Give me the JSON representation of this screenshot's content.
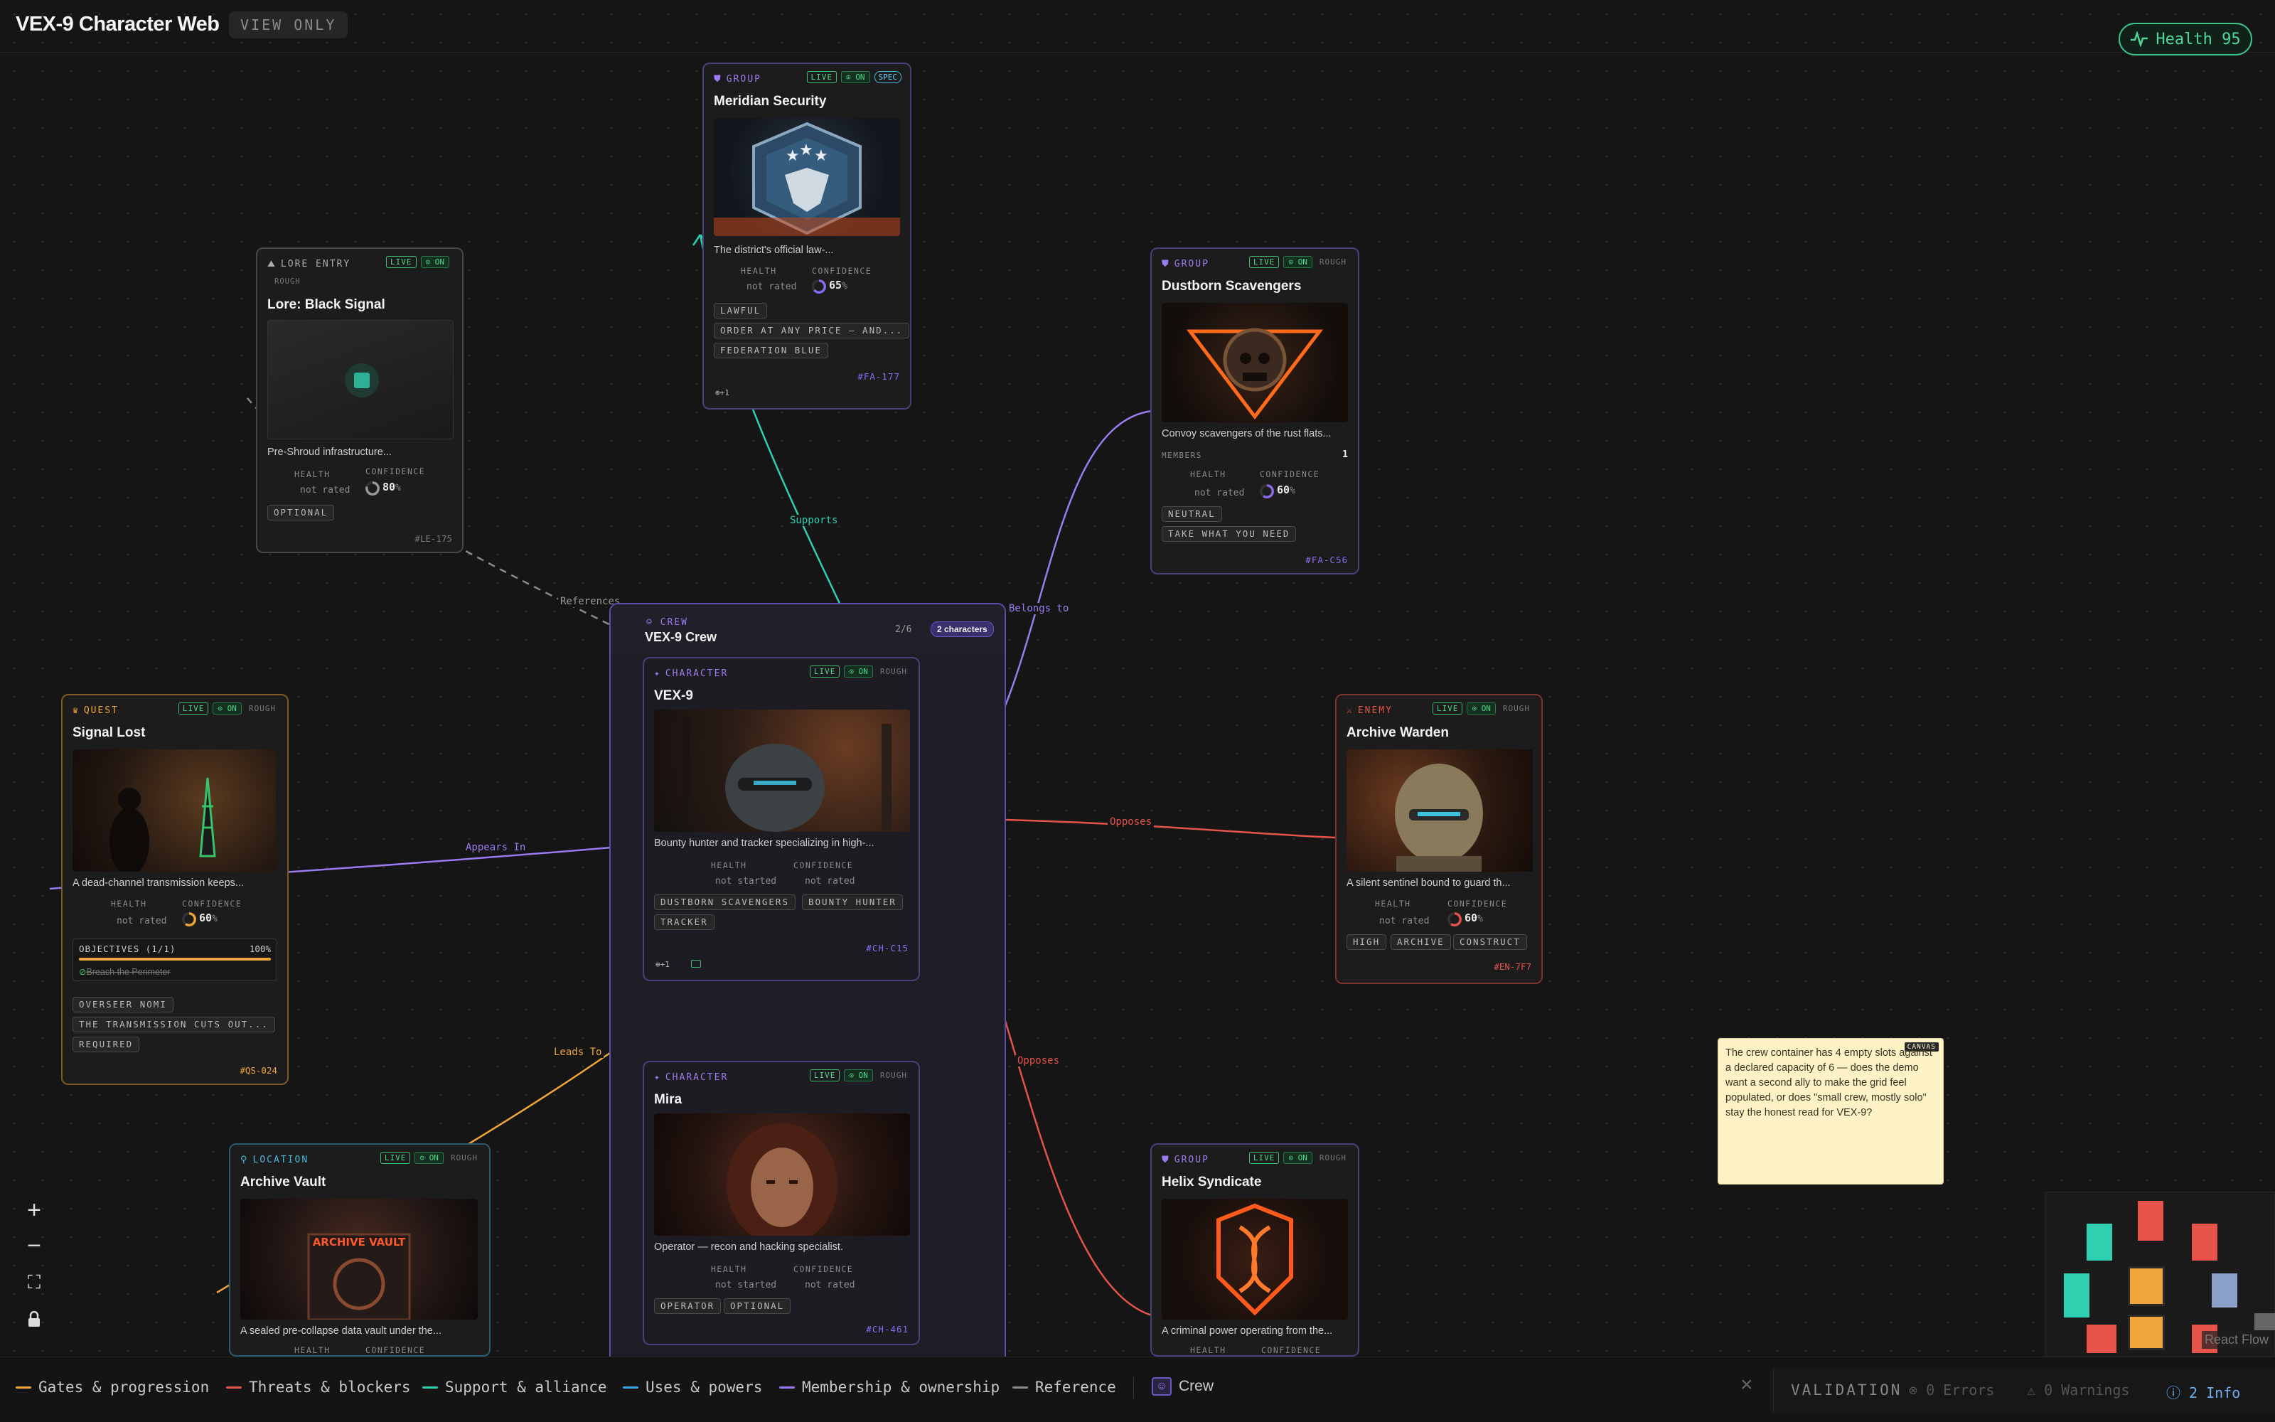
{
  "header": {
    "title": "VEX-9 Character Web",
    "view_badge": "VIEW ONLY",
    "health": "Health 95"
  },
  "edges": {
    "supports": "Supports",
    "references": "References",
    "belongs_to": "Belongs to",
    "opposes_1": "Opposes",
    "opposes_2": "Opposes",
    "appears_in": "Appears In",
    "leads_to": "Leads To"
  },
  "crew": {
    "kind": "CREW",
    "title": "VEX-9 Crew",
    "count": "2/6",
    "characters": "2 characters"
  },
  "cards": {
    "meridian": {
      "kind": "GROUP",
      "live": "LIVE",
      "on": "ON",
      "spec": "SPEC",
      "title": "Meridian Security",
      "desc": "The district's official law-...",
      "health_label": "HEALTH",
      "health": "not rated",
      "conf_label": "CONFIDENCE",
      "conf": "65",
      "conf_unit": "%",
      "tags": [
        "LAWFUL",
        "ORDER AT ANY PRICE — AND...",
        "FEDERATION BLUE"
      ],
      "links": "⊕+1",
      "id": "#FA-177"
    },
    "lore": {
      "kind": "LORE ENTRY",
      "live": "LIVE",
      "on": "ON",
      "rough": "ROUGH",
      "title": "Lore: Black Signal",
      "desc": "Pre-Shroud infrastructure...",
      "health_label": "HEALTH",
      "health": "not rated",
      "conf_label": "CONFIDENCE",
      "conf": "80",
      "conf_unit": "%",
      "tags": [
        "OPTIONAL"
      ],
      "id": "#LE-175"
    },
    "dustborn": {
      "kind": "GROUP",
      "live": "LIVE",
      "on": "ON",
      "rough": "ROUGH",
      "title": "Dustborn Scavengers",
      "desc": "Convoy scavengers of the rust flats...",
      "members_label": "MEMBERS",
      "members": "1",
      "health_label": "HEALTH",
      "health": "not rated",
      "conf_label": "CONFIDENCE",
      "conf": "60",
      "conf_unit": "%",
      "tags": [
        "NEUTRAL",
        "TAKE WHAT YOU NEED"
      ],
      "id": "#FA-C56"
    },
    "signal": {
      "kind": "QUEST",
      "live": "LIVE",
      "on": "ON",
      "rough": "ROUGH",
      "title": "Signal Lost",
      "desc": "A dead-channel transmission keeps...",
      "health_label": "HEALTH",
      "health": "not rated",
      "conf_label": "CONFIDENCE",
      "conf": "60",
      "conf_unit": "%",
      "objectives": "OBJECTIVES (1/1)",
      "objectives_pct": "100%",
      "objective_progress": 1.0,
      "objective_item": "Breach the Perimeter",
      "tags": [
        "OVERSEER NOMI",
        "THE TRANSMISSION CUTS OUT...",
        "REQUIRED"
      ],
      "id": "#QS-024"
    },
    "vex": {
      "kind": "CHARACTER",
      "live": "LIVE",
      "on": "ON",
      "rough": "ROUGH",
      "title": "VEX-9",
      "desc": "Bounty hunter and tracker specializing in high-...",
      "health_label": "HEALTH",
      "health": "not started",
      "conf_label": "CONFIDENCE",
      "conf": "not rated",
      "tags": [
        "DUSTBORN SCAVENGERS",
        "BOUNTY HUNTER",
        "TRACKER"
      ],
      "links": "⊕+1",
      "id": "#CH-C15"
    },
    "warden": {
      "kind": "ENEMY",
      "live": "LIVE",
      "on": "ON",
      "rough": "ROUGH",
      "title": "Archive Warden",
      "desc": "A silent sentinel bound to guard th...",
      "health_label": "HEALTH",
      "health": "not rated",
      "conf_label": "CONFIDENCE",
      "conf": "60",
      "conf_unit": "%",
      "tags": [
        "HIGH",
        "ARCHIVE",
        "CONSTRUCT"
      ],
      "id": "#EN-7F7"
    },
    "mira": {
      "kind": "CHARACTER",
      "live": "LIVE",
      "on": "ON",
      "rough": "ROUGH",
      "title": "Mira",
      "desc": "Operator — recon and hacking specialist.",
      "health_label": "HEALTH",
      "health": "not started",
      "conf_label": "CONFIDENCE",
      "conf": "not rated",
      "tags": [
        "OPERATOR",
        "OPTIONAL"
      ],
      "id": "#CH-461"
    },
    "vault": {
      "kind": "LOCATION",
      "live": "LIVE",
      "on": "ON",
      "rough": "ROUGH",
      "title": "Archive Vault",
      "img_text": "ARCHIVE VAULT",
      "desc": "A sealed pre-collapse data vault under the...",
      "health_label": "HEALTH",
      "conf_label": "CONFIDENCE"
    },
    "helix": {
      "kind": "GROUP",
      "live": "LIVE",
      "on": "ON",
      "rough": "ROUGH",
      "title": "Helix Syndicate",
      "desc": "A criminal power operating from the...",
      "health_label": "HEALTH",
      "conf_label": "CONFIDENCE"
    }
  },
  "note": {
    "tag": "CANVAS",
    "text": "The crew container has 4 empty slots against a declared capacity of 6 — does the demo want a second ally to make the grid feel populated, or does \"small crew, mostly solo\" stay the honest read for VEX-9?"
  },
  "minimap": {
    "watermark": "React Flow"
  },
  "legend": {
    "items": [
      {
        "label": "Gates & progression",
        "color": "#f0a53a"
      },
      {
        "label": "Threats & blockers",
        "color": "#e5534b"
      },
      {
        "label": "Support & alliance",
        "color": "#2fd0b0"
      },
      {
        "label": "Uses & powers",
        "color": "#3fa6e6"
      },
      {
        "label": "Membership & ownership",
        "color": "#9b7cf0"
      },
      {
        "label": "Reference",
        "color": "#8a8a8a"
      }
    ],
    "crew": "Crew"
  },
  "validation": {
    "label": "VALIDATION",
    "errors": "0 Errors",
    "warnings": "0 Warnings",
    "info": "2 Info"
  },
  "colors": {
    "accent_purple": "#8b6cf0",
    "accent_green": "#3ac48a",
    "enemy_red": "#e5534b",
    "quest_orange": "#f0a53a",
    "location_blue": "#4ab7e0"
  }
}
